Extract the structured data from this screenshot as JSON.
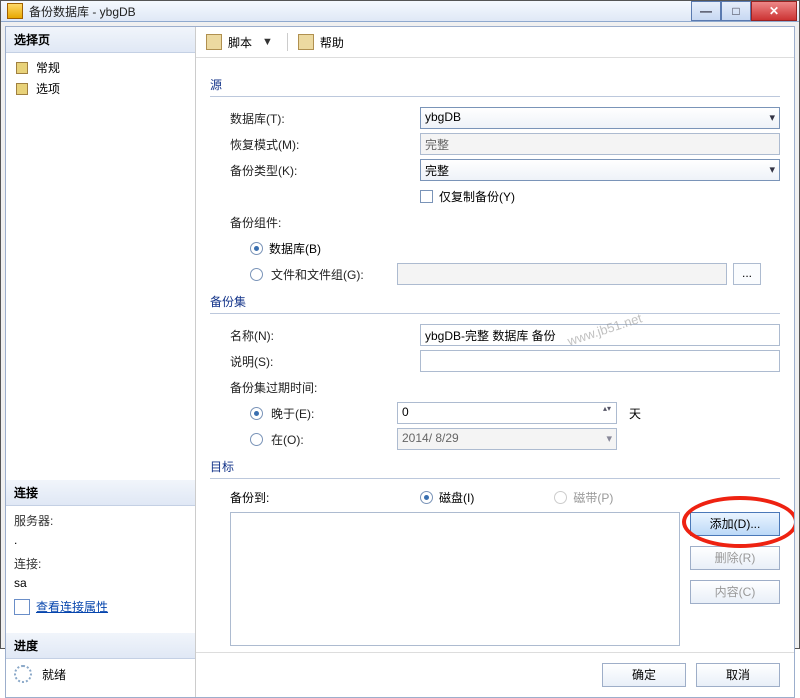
{
  "title": "备份数据库 - ybgDB",
  "sidebar": {
    "select_page": "选择页",
    "items": [
      {
        "label": "常规"
      },
      {
        "label": "选项"
      }
    ],
    "connection_header": "连接",
    "server_label": "服务器:",
    "server_value": ".",
    "conn_label": "连接:",
    "conn_value": "sa",
    "view_conn_props": "查看连接属性",
    "progress_header": "进度",
    "progress_status": "就绪"
  },
  "toolbar": {
    "script": "脚本",
    "help": "帮助"
  },
  "form": {
    "source_header": "源",
    "database_label": "数据库(T):",
    "database_value": "ybgDB",
    "recovery_label": "恢复模式(M):",
    "recovery_value": "完整",
    "backup_type_label": "备份类型(K):",
    "backup_type_value": "完整",
    "copy_only_label": "仅复制备份(Y)",
    "component_label": "备份组件:",
    "component_db": "数据库(B)",
    "component_files": "文件和文件组(G):",
    "set_header": "备份集",
    "name_label": "名称(N):",
    "name_value": "ybgDB-完整 数据库 备份",
    "desc_label": "说明(S):",
    "desc_value": "",
    "expire_label": "备份集过期时间:",
    "expire_after_label": "晚于(E):",
    "expire_after_value": "0",
    "expire_after_unit": "天",
    "expire_on_label": "在(O):",
    "expire_on_value": "2014/ 8/29",
    "dest_header": "目标",
    "dest_label": "备份到:",
    "dest_disk": "磁盘(I)",
    "dest_tape": "磁带(P)",
    "btn_add": "添加(D)...",
    "btn_remove": "删除(R)",
    "btn_contents": "内容(C)"
  },
  "footer": {
    "ok": "确定",
    "cancel": "取消"
  },
  "watermark": "www.jb51.net"
}
